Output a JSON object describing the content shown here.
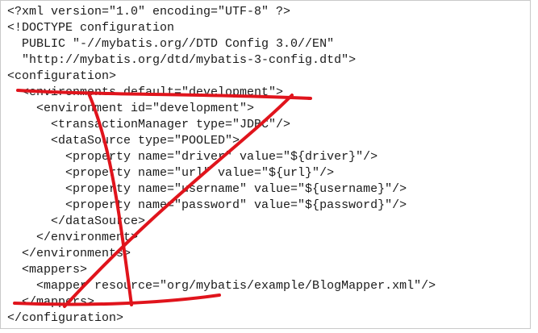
{
  "code": {
    "lines": [
      "<?xml version=\"1.0\" encoding=\"UTF-8\" ?>",
      "<!DOCTYPE configuration",
      "  PUBLIC \"-//mybatis.org//DTD Config 3.0//EN\"",
      "  \"http://mybatis.org/dtd/mybatis-3-config.dtd\">",
      "<configuration>",
      "  <environments default=\"development\">",
      "    <environment id=\"development\">",
      "      <transactionManager type=\"JDBC\"/>",
      "      <dataSource type=\"POOLED\">",
      "        <property name=\"driver\" value=\"${driver}\"/>",
      "        <property name=\"url\" value=\"${url}\"/>",
      "        <property name=\"username\" value=\"${username}\"/>",
      "        <property name=\"password\" value=\"${password}\"/>",
      "      </dataSource>",
      "    </environment>",
      "  </environments>",
      "  <mappers>",
      "    <mapper resource=\"org/mybatis/example/BlogMapper.xml\"/>",
      "  </mappers>",
      "</configuration>"
    ]
  },
  "annotation": {
    "color": "#e0141c"
  }
}
